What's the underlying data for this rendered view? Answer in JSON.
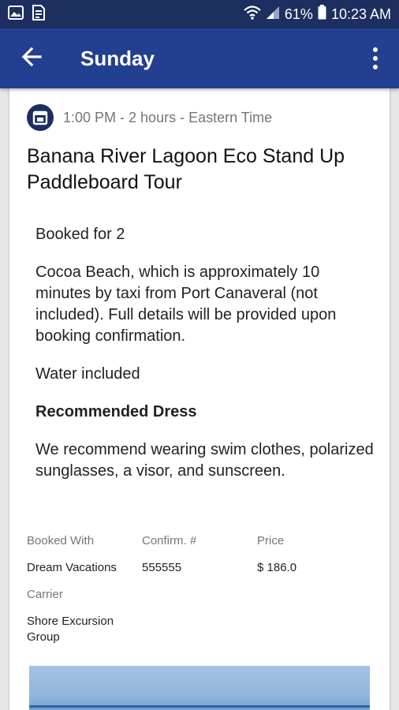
{
  "status_bar": {
    "battery_percent": "61%",
    "time": "10:23 AM",
    "left_icons": [
      "image-icon",
      "document-icon"
    ],
    "right_icons": [
      "wifi-icon",
      "signal-icon",
      "battery-icon"
    ]
  },
  "app_bar": {
    "title": "Sunday",
    "back_icon": "arrow-left-icon",
    "menu_icon": "more-vertical-icon"
  },
  "event": {
    "icon": "calendar-icon",
    "time_line": "1:00 PM - 2 hours  - Eastern Time",
    "title": "Banana River Lagoon Eco Stand Up Paddleboard Tour",
    "booked_for": "Booked for 2",
    "location_note": "Cocoa Beach, which is approximately 10 minutes by taxi from Port Canaveral (not included). Full details will be provided upon booking confirmation.",
    "inclusions": "Water included",
    "dress_heading": "Recommended Dress",
    "dress_text": "We recommend wearing swim clothes, polarized sunglasses, a visor, and sunscreen."
  },
  "booking": {
    "booked_with_label": "Booked With",
    "booked_with_value": "Dream Vacations",
    "confirm_label": "Confirm. #",
    "confirm_value": "555555",
    "price_label": "Price",
    "price_value": "$ 186.0",
    "carrier_label": "Carrier",
    "carrier_value": "Shore Excursion Group"
  },
  "colors": {
    "status_bar": "#1c2f5f",
    "app_bar": "#233f8f",
    "background": "#e6e6e6"
  }
}
